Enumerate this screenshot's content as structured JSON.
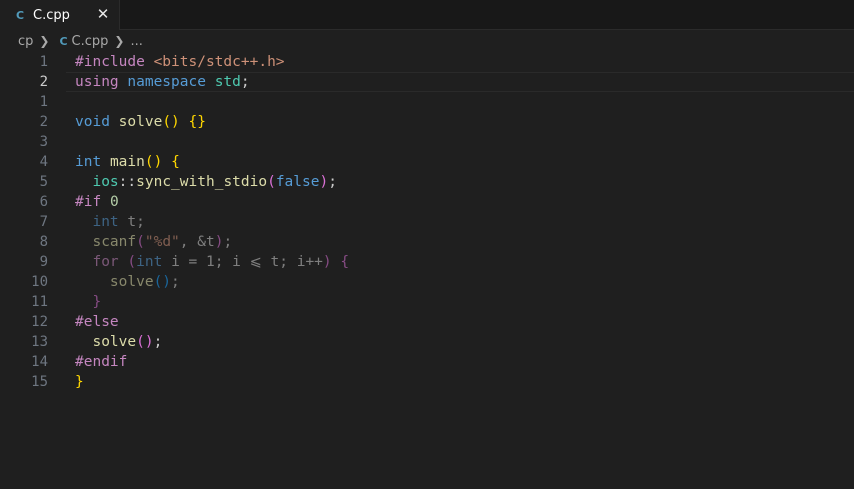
{
  "tabs": [
    {
      "icon": "cpp-file-icon",
      "label": "C.cpp",
      "close": "✕"
    }
  ],
  "breadcrumb": {
    "folder": "cp",
    "file": "C.cpp",
    "more": "..."
  },
  "colors": {
    "background": "#1f1f1f",
    "keyword": "#569cd6",
    "preprocessor": "#c586c0",
    "string": "#ce9178",
    "function": "#dcdcaa",
    "namespace": "#4ec9b0"
  },
  "editor": {
    "line_numbers": [
      "1",
      "2",
      "1",
      "2",
      "3",
      "4",
      "5",
      "6",
      "7",
      "8",
      "9",
      "10",
      "11",
      "12",
      "13",
      "14",
      "15"
    ],
    "current_line_index": 1,
    "tokens": [
      [
        [
          "pp",
          "#include"
        ],
        [
          "txt",
          " "
        ],
        [
          "inc",
          "<bits/stdc++.h>"
        ]
      ],
      [
        [
          "pp",
          "using"
        ],
        [
          "txt",
          " "
        ],
        [
          "kw",
          "namespace"
        ],
        [
          "txt",
          " "
        ],
        [
          "ns",
          "std"
        ],
        [
          "txt",
          ";"
        ]
      ],
      [],
      [
        [
          "kw",
          "void"
        ],
        [
          "txt",
          " "
        ],
        [
          "fn",
          "solve"
        ],
        [
          "br1",
          "()"
        ],
        [
          "txt",
          " "
        ],
        [
          "br1",
          "{}"
        ]
      ],
      [],
      [
        [
          "kw",
          "int"
        ],
        [
          "txt",
          " "
        ],
        [
          "fn",
          "main"
        ],
        [
          "br1",
          "()"
        ],
        [
          "txt",
          " "
        ],
        [
          "br1",
          "{"
        ]
      ],
      [
        [
          "txt",
          "  "
        ],
        [
          "ns",
          "ios"
        ],
        [
          "txt",
          "::"
        ],
        [
          "fn",
          "sync_with_stdio"
        ],
        [
          "br2",
          "("
        ],
        [
          "kw",
          "false"
        ],
        [
          "br2",
          ")"
        ],
        [
          "txt",
          ";"
        ]
      ],
      [
        [
          "pp",
          "#if"
        ],
        [
          "txt",
          " "
        ],
        [
          "num",
          "0"
        ]
      ],
      [
        [
          "txt",
          "  "
        ],
        [
          "kw dim",
          "int"
        ],
        [
          "txt dim",
          " t;"
        ]
      ],
      [
        [
          "txt",
          "  "
        ],
        [
          "fn dim",
          "scanf"
        ],
        [
          "br2 dim",
          "("
        ],
        [
          "str dim",
          "\"%d\""
        ],
        [
          "txt dim",
          ", &t"
        ],
        [
          "br2 dim",
          ")"
        ],
        [
          "txt dim",
          ";"
        ]
      ],
      [
        [
          "txt",
          "  "
        ],
        [
          "pp dim",
          "for"
        ],
        [
          "txt dim",
          " "
        ],
        [
          "br2 dim",
          "("
        ],
        [
          "kw dim",
          "int"
        ],
        [
          "txt dim",
          " i = 1; i ⩽ t; i++"
        ],
        [
          "br2 dim",
          ")"
        ],
        [
          "txt dim",
          " "
        ],
        [
          "br2 dim",
          "{"
        ]
      ],
      [
        [
          "txt",
          "    "
        ],
        [
          "fn dim",
          "solve"
        ],
        [
          "br3 dim",
          "()"
        ],
        [
          "txt dim",
          ";"
        ]
      ],
      [
        [
          "txt",
          "  "
        ],
        [
          "br2 dim",
          "}"
        ]
      ],
      [
        [
          "pp",
          "#else"
        ]
      ],
      [
        [
          "txt",
          "  "
        ],
        [
          "fn",
          "solve"
        ],
        [
          "br2",
          "()"
        ],
        [
          "txt",
          ";"
        ]
      ],
      [
        [
          "pp",
          "#endif"
        ]
      ],
      [
        [
          "br1",
          "}"
        ]
      ]
    ]
  }
}
